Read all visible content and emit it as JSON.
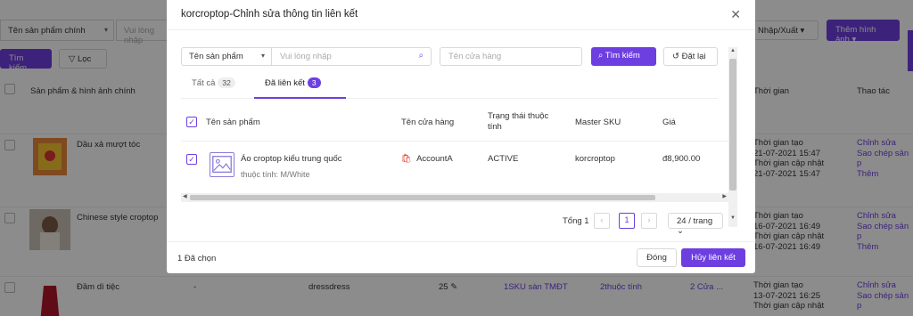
{
  "background": {
    "filter_select": "Tên sản phẩm chính",
    "filter_input_placeholder": "Vui lòng nhập",
    "import_export_label": "Nhập/Xuất",
    "add_image_label": "Thêm hình ảnh",
    "search_label": "Tìm kiếm",
    "filter_label": "Lọc",
    "col_product": "Sản phẩm & hình ảnh chính",
    "col_time": "Thời gian",
    "col_actions": "Thao tác",
    "rows": [
      {
        "name": "Dầu xả mượt tóc",
        "t1": "Thời gian tạo",
        "t2": "21-07-2021 15:47",
        "t3": "Thời gian cập nhật",
        "t4": "21-07-2021 15:47",
        "a1": "Chỉnh sửa",
        "a2": "Sao chép sản p",
        "a3": "Thêm"
      },
      {
        "name": "Chinese style croptop",
        "t1": "Thời gian tạo",
        "t2": "16-07-2021 16:49",
        "t3": "Thời gian cập nhật",
        "t4": "16-07-2021 16:49",
        "a1": "Chỉnh sửa",
        "a2": "Sao chép sản p",
        "a3": "Thêm"
      },
      {
        "name": "Đầm dì tiệc",
        "dash": "-",
        "sku": "dressdress",
        "qty": "25",
        "link_sku": "1SKU sàn TMĐT",
        "attr": "2thuộc tính",
        "stores": "2 Cửa ...",
        "t1": "Thời gian tạo",
        "t2": "13-07-2021 16:25",
        "t3": "Thời gian cập nhật",
        "a1": "Chỉnh sửa",
        "a2": "Sao chép sản p"
      }
    ]
  },
  "modal": {
    "title": "korcroptop-Chỉnh sửa thông tin liên kết",
    "search_field_select": "Tên sản phẩm",
    "search_placeholder": "Vui lòng nhập",
    "store_placeholder": "Tên cửa hàng",
    "search_button": "Tìm kiếm",
    "reset_button": "Đặt lại",
    "tabs": [
      {
        "label": "Tất cả",
        "count": "32"
      },
      {
        "label": "Đã liên kết",
        "count": "3"
      }
    ],
    "columns": {
      "name": "Tên sản phẩm",
      "store": "Tên cửa hàng",
      "status_line1": "Trạng thái thuộc",
      "status_line2": "tính",
      "sku": "Master SKU",
      "price": "Giá"
    },
    "row": {
      "name": "Áo croptop kiểu trung quốc",
      "attr": "thuộc tính: M/White",
      "store": "AccountA",
      "status": "ACTIVE",
      "sku": "korcroptop",
      "price": "đ8,900.00"
    },
    "pagination": {
      "total_label": "Tổng 1",
      "current_page": "1",
      "page_size": "24 / trang"
    },
    "footer": {
      "selected": "1 Đã chọn",
      "close": "Đóng",
      "unlink": "Hủy liên kết"
    }
  },
  "colors": {
    "accent": "#6d3fe0",
    "store_icon": "#e23c2a"
  }
}
